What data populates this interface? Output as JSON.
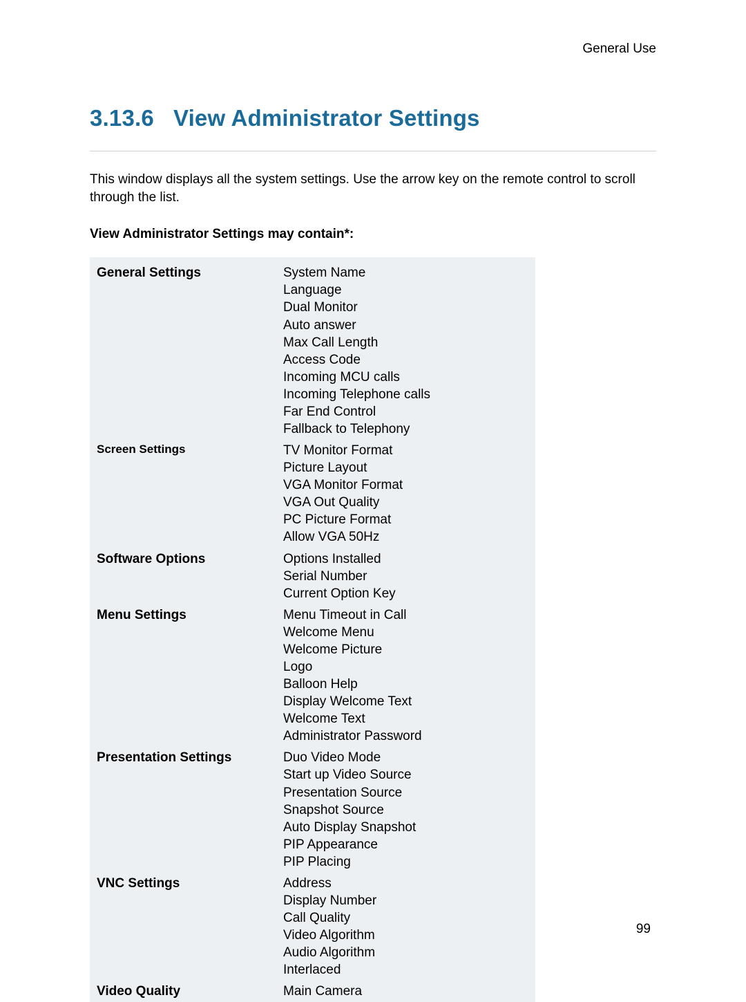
{
  "header": {
    "running_head": "General Use"
  },
  "heading": {
    "number": "3.13.6",
    "title": "View Administrator Settings"
  },
  "intro": "This window displays all the system settings. Use the arrow key on the remote control to scroll through the list.",
  "subhead": "View Administrator Settings may contain*:",
  "table": {
    "rows": [
      {
        "label": "General Settings",
        "items": [
          "System Name",
          "Language",
          "Dual Monitor",
          "Auto answer",
          "Max Call Length",
          "Access Code",
          "Incoming MCU calls",
          "Incoming Telephone calls",
          "Far End Control",
          "Fallback to Telephony"
        ]
      },
      {
        "label": "Screen Settings",
        "label_small": true,
        "items": [
          "TV Monitor Format",
          "Picture Layout",
          "VGA Monitor Format",
          "VGA Out Quality",
          "PC Picture Format",
          "Allow VGA 50Hz"
        ]
      },
      {
        "label": "Software Options",
        "items": [
          "Options Installed",
          "Serial Number",
          "Current Option Key"
        ]
      },
      {
        "label": "Menu Settings",
        "items": [
          "Menu Timeout in Call",
          "Welcome Menu",
          "Welcome Picture",
          "Logo",
          "Balloon Help",
          "Display Welcome Text",
          "Welcome Text",
          "Administrator Password"
        ]
      },
      {
        "label": "Presentation Settings",
        "items": [
          "Duo Video Mode",
          "Start up Video Source",
          "Presentation Source",
          "Snapshot Source",
          "Auto Display Snapshot",
          "PIP Appearance",
          "PIP Placing"
        ]
      },
      {
        "label": "VNC Settings",
        "items": [
          "Address",
          "Display Number",
          "Call Quality",
          "Video Algorithm",
          "Audio Algorithm",
          "Interlaced"
        ]
      },
      {
        "label": "Video Quality",
        "items": [
          "Main Camera"
        ]
      }
    ]
  },
  "page_number": "99"
}
